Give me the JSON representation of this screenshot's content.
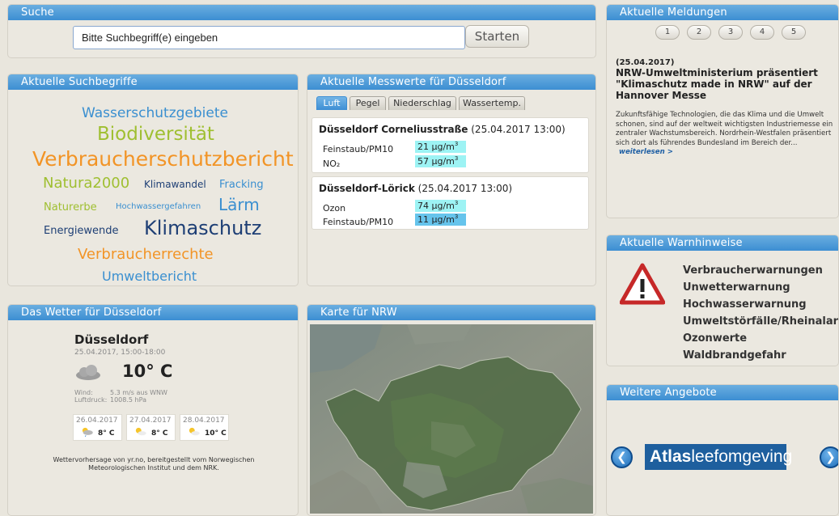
{
  "search": {
    "title": "Suche",
    "placeholder": "Bitte Suchbegriff(e) eingeben",
    "button_label": "Starten"
  },
  "tags": {
    "title": "Aktuelle Suchbegriffe",
    "items": [
      {
        "label": "Wasserschutzgebiete",
        "color": "#3a8fd0"
      },
      {
        "label": "Biodiversität",
        "color": "#9fbf31"
      },
      {
        "label": "Verbraucherschutzbericht",
        "color": "#f29426"
      },
      {
        "label": "Natura2000",
        "color": "#9fbf31"
      },
      {
        "label": "Klimawandel",
        "color": "#1e3f75"
      },
      {
        "label": "Fracking",
        "color": "#3a8fd0"
      },
      {
        "label": "Naturerbe",
        "color": "#9fbf31"
      },
      {
        "label": "Hochwassergefahren",
        "color": "#3a8fd0"
      },
      {
        "label": "Lärm",
        "color": "#3a8fd0"
      },
      {
        "label": "Energiewende",
        "color": "#1e3f75"
      },
      {
        "label": "Klimaschutz",
        "color": "#1e3f75"
      },
      {
        "label": "Verbraucherrechte",
        "color": "#f29426"
      },
      {
        "label": "Umweltbericht",
        "color": "#3a8fd0"
      }
    ]
  },
  "measurements": {
    "title": "Aktuelle Messwerte für Düsseldorf",
    "tabs": [
      "Luft",
      "Pegel",
      "Niederschlag",
      "Wassertemp."
    ],
    "active_tab": "Luft",
    "stations": [
      {
        "name": "Düsseldorf Corneliusstraße",
        "datetime": "(25.04.2017 13:00)",
        "readings": [
          {
            "label": "Feinstaub/PM10",
            "value": "21 µg/m",
            "sup": "3"
          },
          {
            "label": "NO₂",
            "value": "57 µg/m",
            "sup": "3"
          }
        ]
      },
      {
        "name": "Düsseldorf-Lörick",
        "datetime": "(25.04.2017 13:00)",
        "readings": [
          {
            "label": "Ozon",
            "value": "74 µg/m",
            "sup": "3"
          },
          {
            "label": "Feinstaub/PM10",
            "value": "11 µg/m",
            "sup": "3"
          }
        ]
      }
    ]
  },
  "news": {
    "title": "Aktuelle Meldungen",
    "pages": [
      "1",
      "2",
      "3",
      "4",
      "5"
    ],
    "date": "(25.04.2017)",
    "headline": "NRW-Umweltministerium präsentiert \"Klimaschutz made in NRW\" auf der Hannover Messe",
    "body": "Zukunftsfähige Technologien, die das Klima und die Umwelt schonen, sind auf der weltweit wichtigsten Industriemesse ein zentraler Wachstumsbereich. Nordrhein-Westfalen präsentiert sich dort als führendes Bundesland im Bereich der...",
    "more_link": "weiterlesen >"
  },
  "warnings": {
    "title": "Aktuelle Warnhinweise",
    "links": [
      "Verbraucherwarnungen",
      "Unwetterwarnung",
      "Hochwasserwarnung",
      "Umweltstörfälle/Rheinalarm",
      "Ozonwerte",
      "Waldbrandgefahr"
    ]
  },
  "weather": {
    "title": "Das Wetter für Düsseldorf",
    "city": "Düsseldorf",
    "period": "25.04.2017, 15:00-18:00",
    "temperature": "10° C",
    "wind_label": "Wind:",
    "wind_value": "5.3 m/s aus WNW",
    "pressure_label": "Luftdruck:",
    "pressure_value": "1008.5 hPa",
    "forecast": [
      {
        "date": "26.04.2017",
        "temp": "8° C"
      },
      {
        "date": "27.04.2017",
        "temp": "8° C"
      },
      {
        "date": "28.04.2017",
        "temp": "10° C"
      }
    ],
    "credit": "Wettervorhersage von yr.no, bereitgestellt vom Norwegischen Meteorologischen Institut und dem NRK."
  },
  "map": {
    "title": "Karte für NRW"
  },
  "offers": {
    "title": "Weitere Angebote",
    "brand_bold": "Atlas",
    "brand_light": "leefomgeving",
    "brand_color": "#1e5f9e"
  }
}
